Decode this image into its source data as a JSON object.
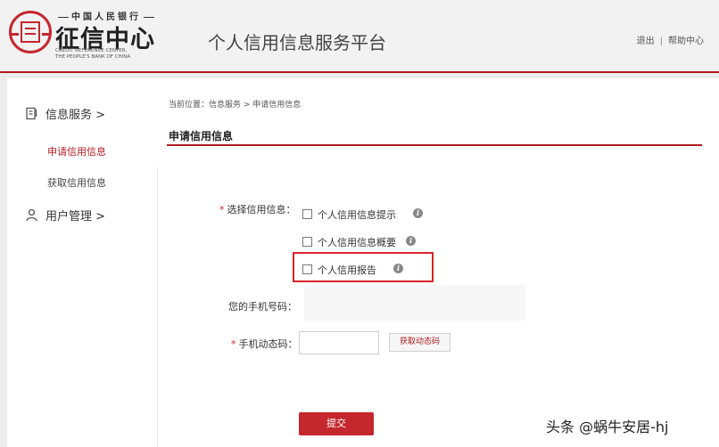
{
  "header": {
    "logo_bank_cn": "中国人民银行",
    "logo_main": "征信中心",
    "logo_en_1": "CREDIT REFERENCE CENTER,",
    "logo_en_2": "THE PEOPLE'S BANK OF CHINA",
    "platform_title": "个人信用信息服务平台",
    "logout": "退出",
    "separator": "|",
    "help": "帮助中心"
  },
  "sidebar": {
    "group_info": "信息服务 >",
    "item_apply": "申请信用信息",
    "item_get": "获取信用信息",
    "group_user": "用户管理 >"
  },
  "breadcrumb": "当前位置：信息服务 > 申请信用信息",
  "page_title": "申请信用信息",
  "form": {
    "select_label": "选择信用信息：",
    "required_mark": "*",
    "options": [
      "个人信用信息提示",
      "个人信用信息概要",
      "个人信用报告"
    ],
    "info_icon": "i",
    "phone_label": "您的手机号码：",
    "code_label": "手机动态码：",
    "get_code": "获取动态码",
    "submit": "提交"
  },
  "watermark": "头条 @蜗牛安居-hj",
  "colors": {
    "accent": "#b01c20",
    "highlight": "#d8232a"
  }
}
